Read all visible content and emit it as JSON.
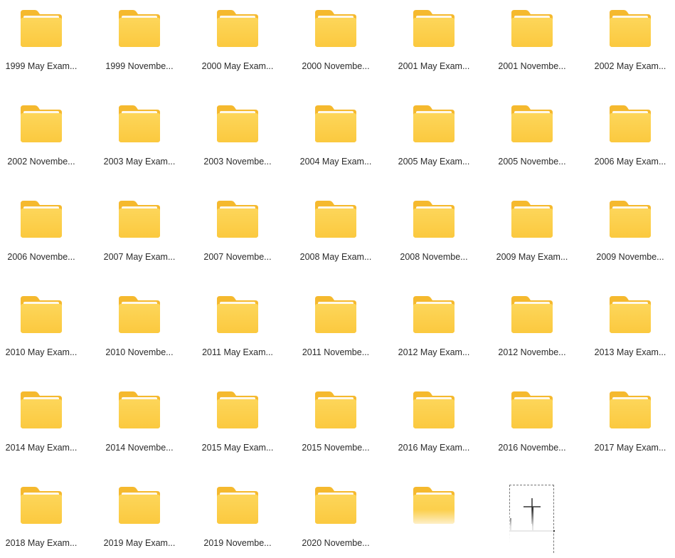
{
  "folders": [
    {
      "label": "1999 May Exam..."
    },
    {
      "label": "1999 Novembe..."
    },
    {
      "label": "2000 May Exam..."
    },
    {
      "label": "2000 Novembe..."
    },
    {
      "label": "2001 May Exam..."
    },
    {
      "label": "2001 Novembe..."
    },
    {
      "label": "2002 May Exam..."
    },
    {
      "label": "2002 Novembe..."
    },
    {
      "label": "2003 May Exam..."
    },
    {
      "label": "2003 Novembe..."
    },
    {
      "label": "2004 May Exam..."
    },
    {
      "label": "2005 May Exam..."
    },
    {
      "label": "2005 Novembe..."
    },
    {
      "label": "2006 May Exam..."
    },
    {
      "label": "2006 Novembe..."
    },
    {
      "label": "2007 May Exam..."
    },
    {
      "label": "2007 Novembe..."
    },
    {
      "label": "2008 May Exam..."
    },
    {
      "label": "2008 Novembe..."
    },
    {
      "label": "2009 May Exam..."
    },
    {
      "label": "2009 Novembe..."
    },
    {
      "label": "2010 May Exam..."
    },
    {
      "label": "2010 Novembe..."
    },
    {
      "label": "2011 May Exam..."
    },
    {
      "label": "2011 Novembe..."
    },
    {
      "label": "2012 May Exam..."
    },
    {
      "label": "2012 Novembe..."
    },
    {
      "label": "2013 May Exam..."
    },
    {
      "label": "2014 May Exam..."
    },
    {
      "label": "2014 Novembe..."
    },
    {
      "label": "2015 May Exam..."
    },
    {
      "label": "2015 Novembe..."
    },
    {
      "label": "2016 May Exam..."
    },
    {
      "label": "2016 Novembe..."
    },
    {
      "label": "2017 May Exam..."
    },
    {
      "label": "2018 May Exam..."
    },
    {
      "label": "2019 May Exam..."
    },
    {
      "label": "2019 Novembe..."
    },
    {
      "label": "2020 Novembe..."
    },
    {
      "label": ""
    }
  ],
  "colors": {
    "folder_back": "#f5b92e",
    "folder_front": "#fdd65a",
    "folder_front_bottom": "#fbc93f",
    "label_text": "#2b2b2b"
  },
  "icons": {
    "folder": "folder-icon",
    "cursor": "move-cursor-icon"
  }
}
